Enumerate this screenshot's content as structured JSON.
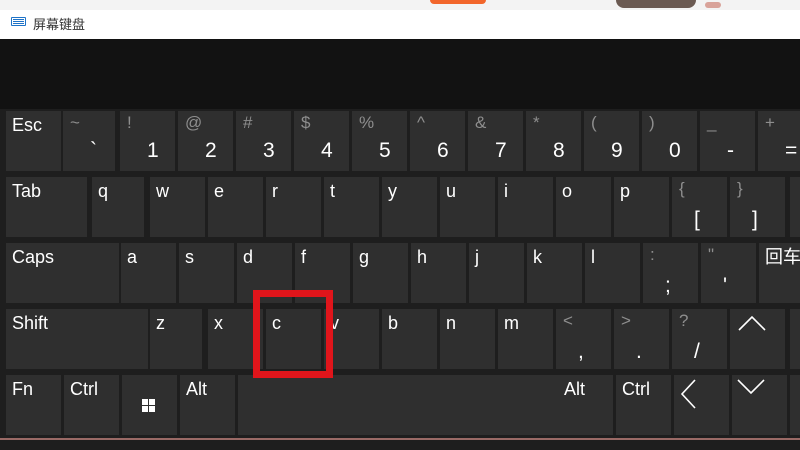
{
  "window": {
    "title": "屏幕键盘"
  },
  "rows": [
    [
      {
        "id": "esc",
        "label": "Esc"
      },
      {
        "id": "backtick",
        "secondary": "~",
        "primary": "`"
      },
      {
        "id": "1",
        "secondary": "!",
        "primary": "1"
      },
      {
        "id": "2",
        "secondary": "@",
        "primary": "2"
      },
      {
        "id": "3",
        "secondary": "#",
        "primary": "3"
      },
      {
        "id": "4",
        "secondary": "$",
        "primary": "4"
      },
      {
        "id": "5",
        "secondary": "%",
        "primary": "5"
      },
      {
        "id": "6",
        "secondary": "^",
        "primary": "6"
      },
      {
        "id": "7",
        "secondary": "&",
        "primary": "7"
      },
      {
        "id": "8",
        "secondary": "*",
        "primary": "8"
      },
      {
        "id": "9",
        "secondary": "(",
        "primary": "9"
      },
      {
        "id": "0",
        "secondary": ")",
        "primary": "0"
      },
      {
        "id": "minus",
        "secondary": "_",
        "primary": "-"
      },
      {
        "id": "equals",
        "secondary": "+",
        "primary": "="
      }
    ],
    [
      {
        "id": "tab",
        "label": "Tab"
      },
      {
        "id": "q",
        "label": "q"
      },
      {
        "id": "w",
        "label": "w"
      },
      {
        "id": "e",
        "label": "e"
      },
      {
        "id": "r",
        "label": "r"
      },
      {
        "id": "t",
        "label": "t"
      },
      {
        "id": "y",
        "label": "y"
      },
      {
        "id": "u",
        "label": "u"
      },
      {
        "id": "i",
        "label": "i"
      },
      {
        "id": "o",
        "label": "o"
      },
      {
        "id": "p",
        "label": "p"
      },
      {
        "id": "lbracket",
        "secondary": "{",
        "primary": "["
      },
      {
        "id": "rbracket",
        "secondary": "}",
        "primary": "]"
      },
      {
        "id": "backslash-partial"
      }
    ],
    [
      {
        "id": "caps",
        "label": "Caps"
      },
      {
        "id": "a",
        "label": "a"
      },
      {
        "id": "s",
        "label": "s"
      },
      {
        "id": "d",
        "label": "d"
      },
      {
        "id": "f",
        "label": "f"
      },
      {
        "id": "g",
        "label": "g"
      },
      {
        "id": "h",
        "label": "h"
      },
      {
        "id": "j",
        "label": "j"
      },
      {
        "id": "k",
        "label": "k"
      },
      {
        "id": "l",
        "label": "l"
      },
      {
        "id": "semicolon",
        "secondary": ":",
        "primary": ";"
      },
      {
        "id": "quote",
        "secondary": "\"",
        "primary": "'"
      },
      {
        "id": "enter",
        "label": "回车"
      }
    ],
    [
      {
        "id": "shift",
        "label": "Shift"
      },
      {
        "id": "z",
        "label": "z"
      },
      {
        "id": "x",
        "label": "x"
      },
      {
        "id": "c",
        "label": "c"
      },
      {
        "id": "v",
        "label": "v"
      },
      {
        "id": "b",
        "label": "b"
      },
      {
        "id": "n",
        "label": "n"
      },
      {
        "id": "m",
        "label": "m"
      },
      {
        "id": "comma",
        "secondary": "<",
        "primary": ","
      },
      {
        "id": "period",
        "secondary": ">",
        "primary": "."
      },
      {
        "id": "slash",
        "secondary": "?",
        "primary": "/"
      },
      {
        "id": "up",
        "icon": "up-arrow-icon"
      },
      {
        "id": "del-partial"
      }
    ],
    [
      {
        "id": "fn",
        "label": "Fn"
      },
      {
        "id": "ctrl-left",
        "label": "Ctrl"
      },
      {
        "id": "win",
        "icon": "windows-logo-icon"
      },
      {
        "id": "alt-left",
        "label": "Alt"
      },
      {
        "id": "space"
      },
      {
        "id": "alt-right",
        "label": "Alt"
      },
      {
        "id": "ctrl-right",
        "label": "Ctrl"
      },
      {
        "id": "left",
        "icon": "left-arrow-icon"
      },
      {
        "id": "down",
        "icon": "down-arrow-icon"
      },
      {
        "id": "right-partial"
      }
    ]
  ],
  "highlight": {
    "key": "c",
    "color": "#e0151b"
  },
  "colors": {
    "key_bg": "#2f2f2f",
    "band_bg": "#121212",
    "secondary_text": "#8e8e8e"
  }
}
